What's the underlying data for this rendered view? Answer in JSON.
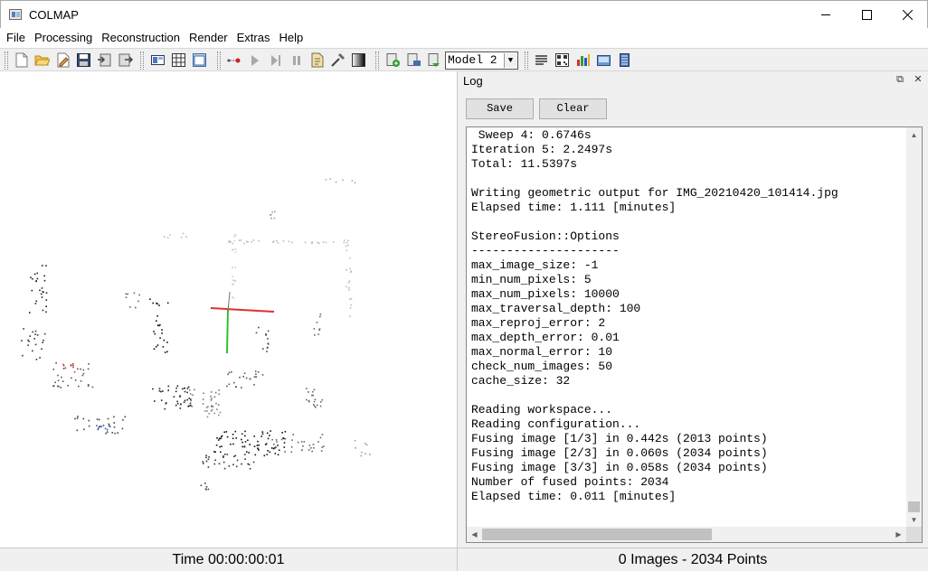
{
  "window": {
    "title": "COLMAP"
  },
  "menu": [
    "File",
    "Processing",
    "Reconstruction",
    "Render",
    "Extras",
    "Help"
  ],
  "toolbar": {
    "model_select": "Model 2",
    "icons": [
      "new-project-icon",
      "open-project-icon",
      "edit-project-icon",
      "save-project-icon",
      "import-model-icon",
      "export-model-icon",
      "feature-extraction-icon",
      "feature-matching-icon",
      "database-icon",
      "begin-reconstruction-icon",
      "start-icon",
      "step-icon",
      "pause-icon",
      "reset-icon",
      "bundle-adjustment-icon",
      "dense-reconstruction-icon",
      "grab-image-icon",
      "add-model-icon",
      "delete-model-icon",
      "model-stats-icon",
      "render-options-icon",
      "match-matrix-icon",
      "show-log-icon",
      "grab-movie-icon",
      "undistortion-icon"
    ]
  },
  "log": {
    "title": "Log",
    "save_label": "Save",
    "clear_label": "Clear",
    "lines": [
      " Sweep 4: 0.6746s",
      "Iteration 5: 2.2497s",
      "Total: 11.5397s",
      "",
      "Writing geometric output for IMG_20210420_101414.jpg",
      "Elapsed time: 1.111 [minutes]",
      "",
      "StereoFusion::Options",
      "---------------------",
      "max_image_size: -1",
      "min_num_pixels: 5",
      "max_num_pixels: 10000",
      "max_traversal_depth: 100",
      "max_reproj_error: 2",
      "max_depth_error: 0.01",
      "max_normal_error: 10",
      "check_num_images: 50",
      "cache_size: 32",
      "",
      "Reading workspace...",
      "Reading configuration...",
      "Fusing image [1/3] in 0.442s (2013 points)",
      "Fusing image [2/3] in 0.060s (2034 points)",
      "Fusing image [3/3] in 0.058s (2034 points)",
      "Number of fused points: 2034",
      "Elapsed time: 0.011 [minutes]"
    ]
  },
  "status": {
    "time": "Time 00:00:00:01",
    "counts": "0 Images - 2034 Points"
  },
  "colors": {
    "axis_x": "#e03030",
    "axis_y": "#30c030",
    "axis_z": "#707070",
    "points_dark": "#111111",
    "points_gray": "#888888"
  }
}
